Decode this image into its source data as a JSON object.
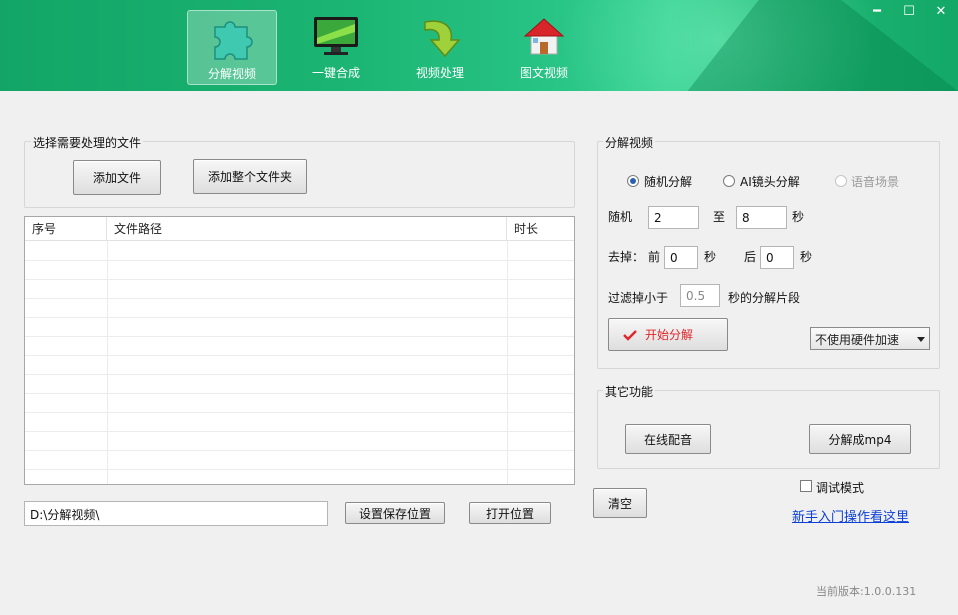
{
  "nav": {
    "tabs": [
      {
        "label": "分解视频",
        "icon": "puzzle-icon",
        "active": true
      },
      {
        "label": "一键合成",
        "icon": "monitor-icon"
      },
      {
        "label": "视频处理",
        "icon": "arrow-down-icon"
      },
      {
        "label": "图文视频",
        "icon": "house-icon"
      }
    ]
  },
  "window": {
    "minimize": "━",
    "maximize": "☐",
    "close": "✕"
  },
  "files": {
    "group_title": "选择需要处理的文件",
    "add_file": "添加文件",
    "add_folder": "添加整个文件夹",
    "columns": [
      "序号",
      "文件路径",
      "时长"
    ],
    "rows": []
  },
  "save": {
    "path": "D:\\分解视频\\",
    "set_location": "设置保存位置",
    "open_location": "打开位置",
    "clear": "清空"
  },
  "split": {
    "group_title": "分解视频",
    "mode_options": [
      {
        "label": "随机分解",
        "selected": true,
        "disabled": false
      },
      {
        "label": "AI镜头分解",
        "selected": false,
        "disabled": false
      },
      {
        "label": "语音场景",
        "selected": false,
        "disabled": true
      }
    ],
    "random_label": "随机",
    "random_from": "2",
    "to_label": "至",
    "random_to": "8",
    "sec": "秒",
    "trim_label": "去掉：",
    "front_label": "前",
    "front_value": "0",
    "back_label": "后",
    "back_value": "0",
    "filter_label": "过滤掉小于",
    "filter_value": "0.5",
    "filter_suffix": "秒的分解片段",
    "start": "开始分解",
    "hw_accel": "不使用硬件加速"
  },
  "other": {
    "group_title": "其它功能",
    "online_dub": "在线配音",
    "to_mp4": "分解成mp4"
  },
  "debug_label": "调试模式",
  "help_link": "新手入门操作看这里",
  "version": "当前版本:1.0.0.131",
  "colors": {
    "accent_red": "#e0262a",
    "link": "#0b3fd6",
    "banner": "#1bb472"
  }
}
